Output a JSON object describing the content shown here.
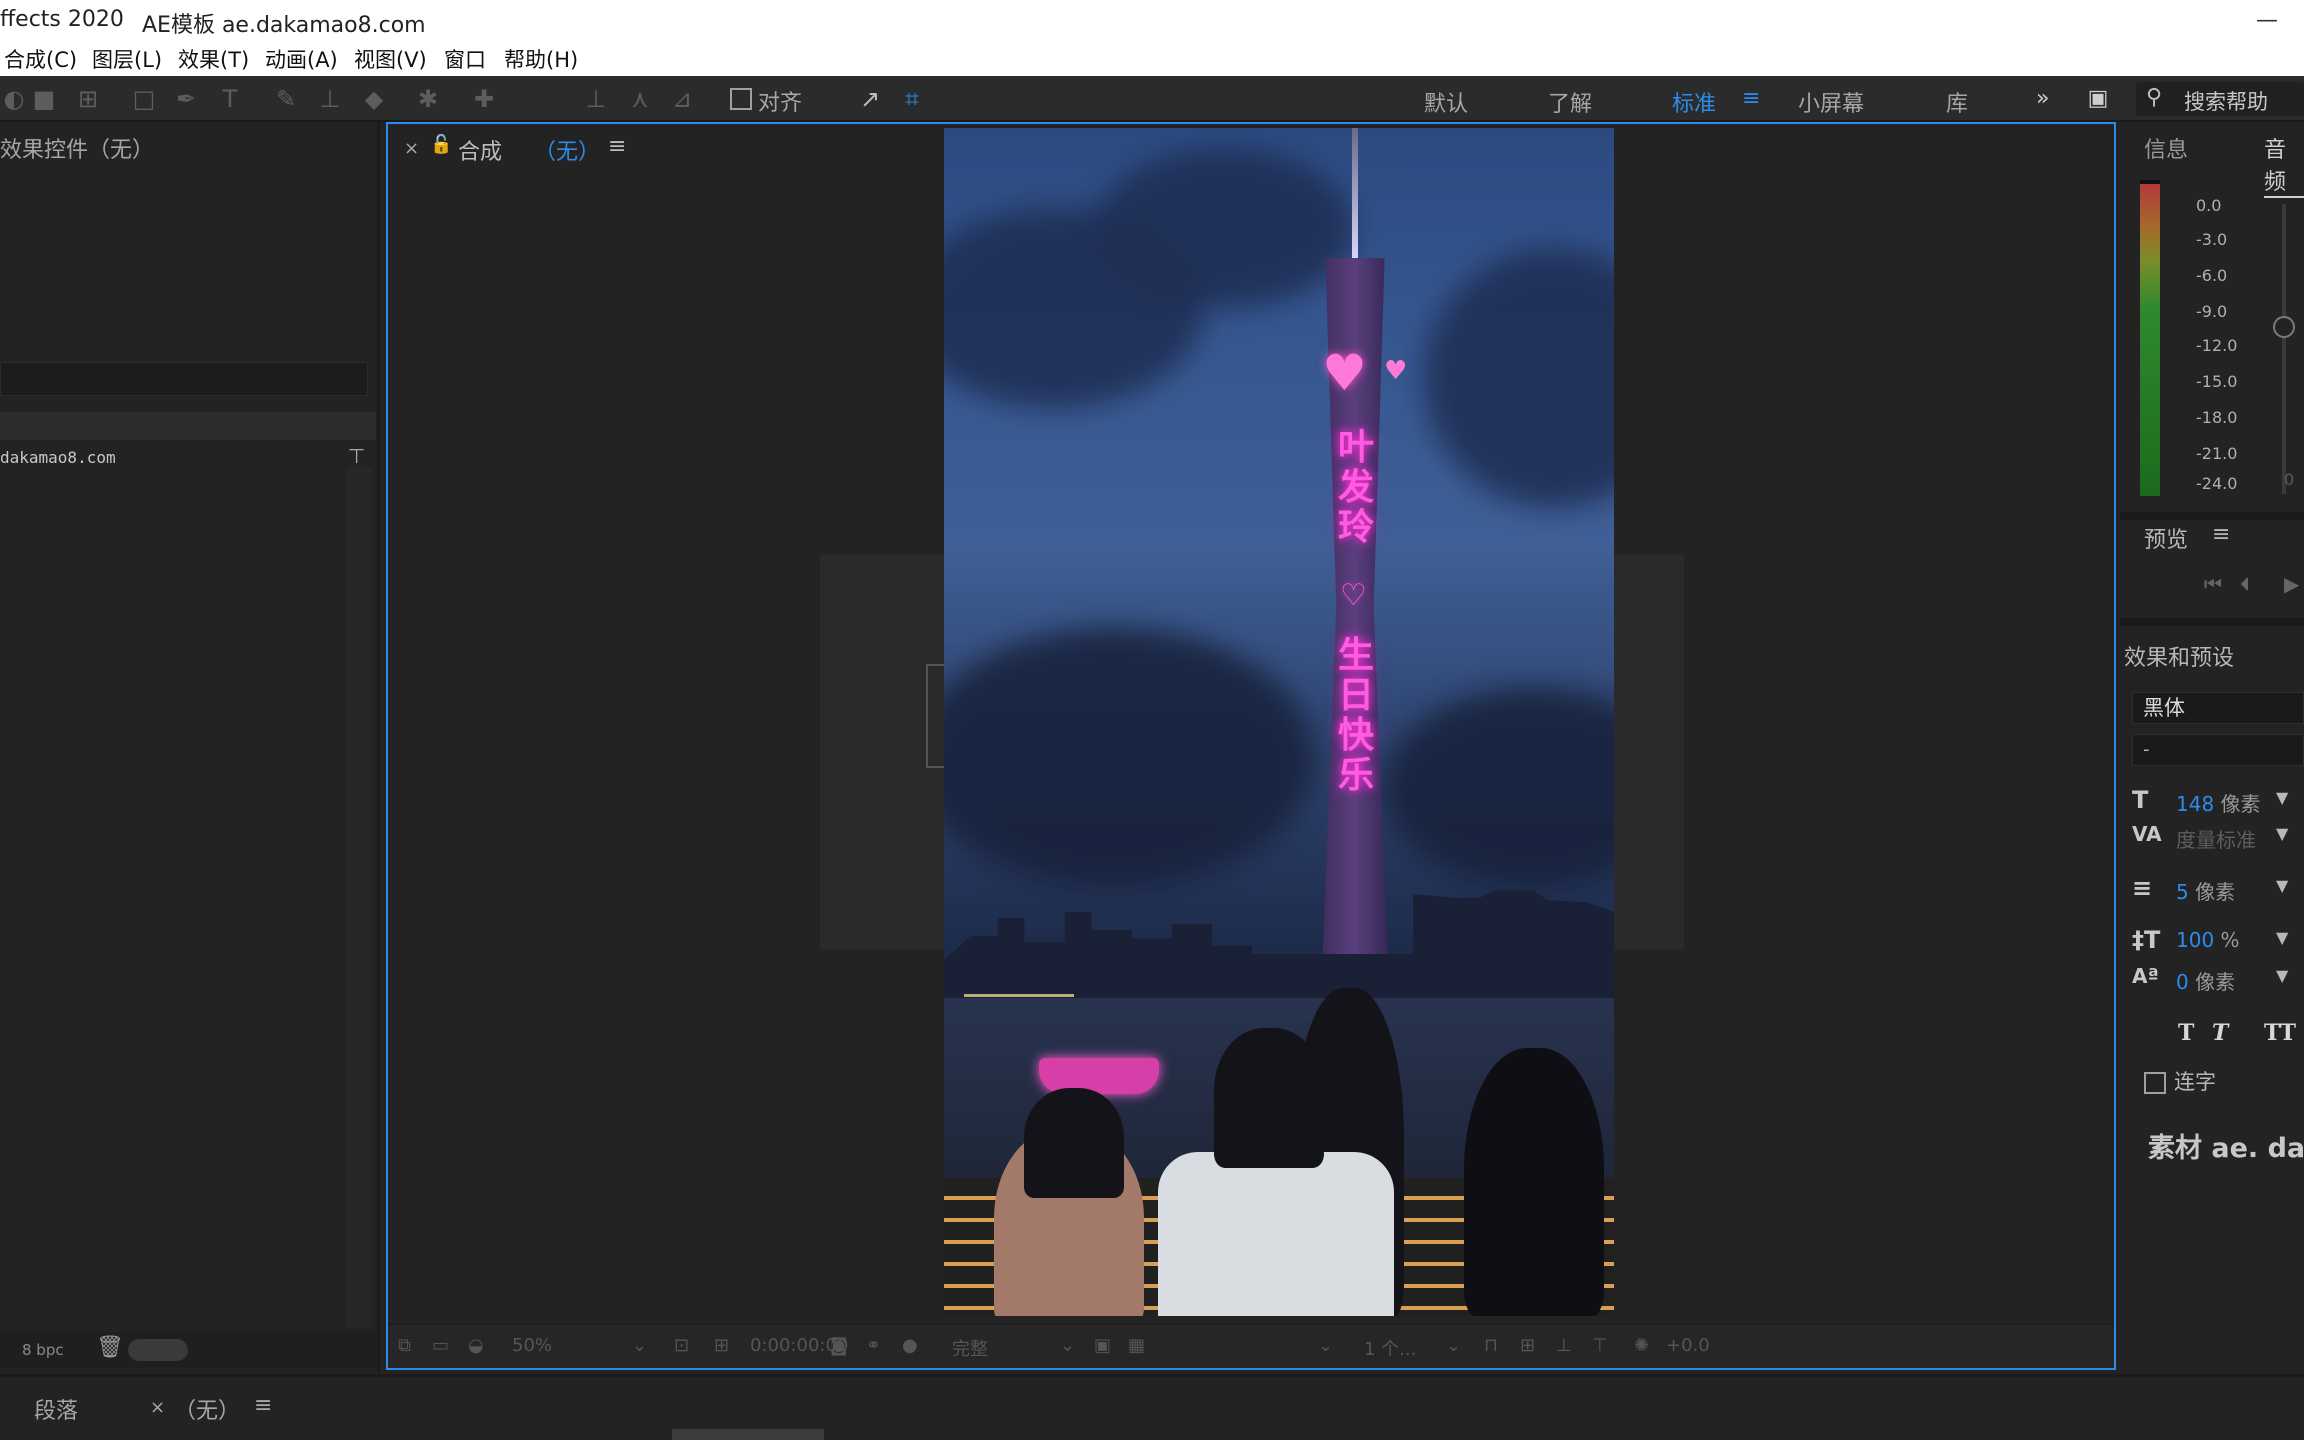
{
  "titlebar": {
    "app_title": "ffects 2020",
    "doc_title": "AE模板 ae.dakamao8.com",
    "minimize": "—"
  },
  "menubar": {
    "items": [
      "合成(C)",
      "图层(L)",
      "效果(T)",
      "动画(A)",
      "视图(V)",
      "窗口",
      "帮助(H)"
    ]
  },
  "toolbar": {
    "align_label": "对齐",
    "workspaces": [
      "默认",
      "了解",
      "标准",
      "小屏幕",
      "库"
    ],
    "active_workspace": "标准",
    "workspace_menu_icon": "≡",
    "overflow": "»",
    "search_placeholder": "搜索帮助"
  },
  "left_panel": {
    "title": "效果控件（无）",
    "project_item": "dakamao8.com",
    "footer_bpc": "8 bpc"
  },
  "comp_panel": {
    "tab_close": "×",
    "tab_name": "合成",
    "tab_sub": "（无）",
    "tab_menu": "≡",
    "neon_text_1": [
      "叶",
      "发",
      "玲"
    ],
    "neon_text_2": [
      "生",
      "日",
      "快",
      "乐"
    ],
    "footer": {
      "zoom": "50%",
      "timecode": "0:00:00:00",
      "quality": "完整",
      "view": "1 个...",
      "exposure": "+0.0"
    }
  },
  "right_panel": {
    "tabs": [
      "信息",
      "音频"
    ],
    "audio_levels": [
      "0.0",
      "-3.0",
      "-6.0",
      "-9.0",
      "-12.0",
      "-15.0",
      "-18.0",
      "-21.0",
      "-24.0"
    ],
    "audio_zero": "0",
    "preview_title": "预览",
    "effects_title": "效果和预设",
    "font_family": "黑体",
    "font_style": "-",
    "font_size": {
      "value": "148",
      "unit": "像素"
    },
    "kerning": {
      "value": "度量标准"
    },
    "stroke": {
      "value": "5",
      "unit": "像素"
    },
    "vertical_scale": {
      "value": "100",
      "unit": "%"
    },
    "baseline": {
      "value": "0",
      "unit": "像素"
    },
    "text_styles": [
      "T",
      "T",
      "TT"
    ],
    "ligature_label": "连字",
    "watermark": "素材 ae. dak"
  },
  "bottom_bar": {
    "tab_paragraph": "段落",
    "close": "×",
    "tab_none": "（无）",
    "menu": "≡"
  },
  "colors": {
    "accent": "#2d8ceb",
    "panel_bg": "#232323",
    "neon": "#ff5ce0"
  }
}
